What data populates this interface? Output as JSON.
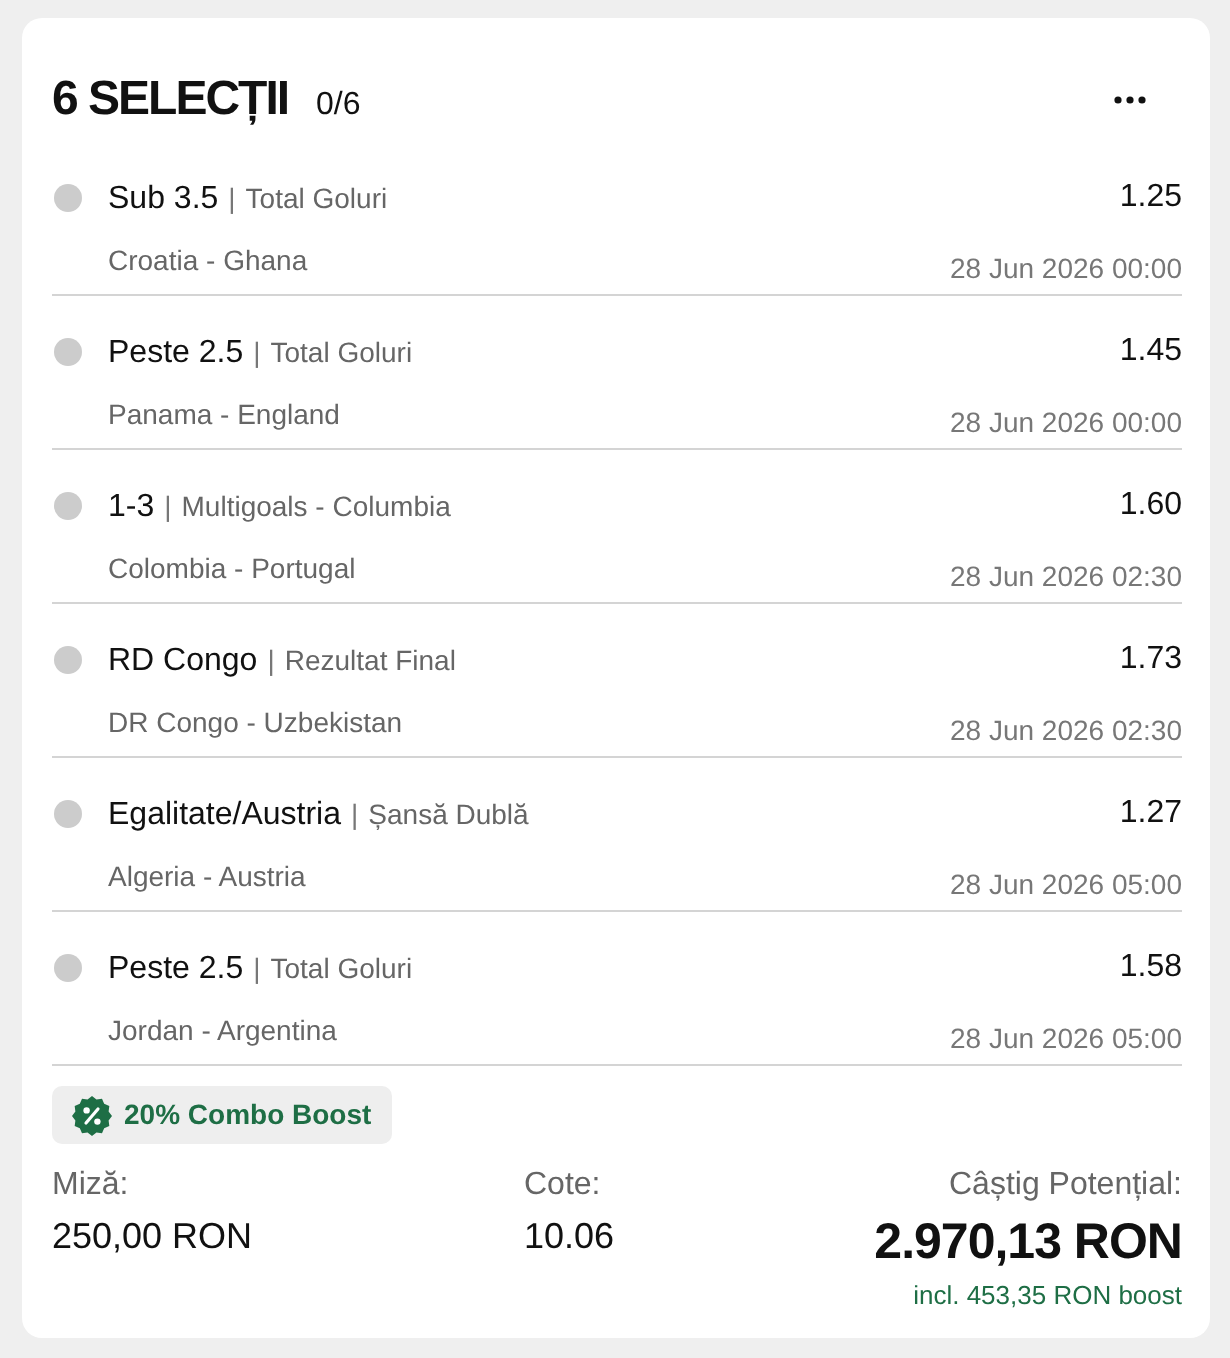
{
  "header": {
    "title": "6 SELECȚII",
    "progress": "0/6"
  },
  "selections": [
    {
      "pick": "Sub 3.5",
      "separator": "|",
      "market": "Total Goluri",
      "odds": "1.25",
      "match": "Croatia - Ghana",
      "date": "28 Jun 2026 00:00",
      "color": "#cccccc"
    },
    {
      "pick": "Peste 2.5",
      "separator": "|",
      "market": "Total Goluri",
      "odds": "1.45",
      "match": "Panama - England",
      "date": "28 Jun 2026 00:00",
      "color": "#cccccc"
    },
    {
      "pick": "1-3",
      "separator": "|",
      "market": "Multigoals - Columbia",
      "odds": "1.60",
      "match": "Colombia - Portugal",
      "date": "28 Jun 2026 02:30",
      "color": "#cccccc"
    },
    {
      "pick": "RD Congo",
      "separator": "|",
      "market": "Rezultat Final",
      "odds": "1.73",
      "match": "DR Congo - Uzbekistan",
      "date": "28 Jun 2026 02:30",
      "color": "#cccccc"
    },
    {
      "pick": "Egalitate/Austria",
      "separator": "|",
      "market": "Șansă Dublă",
      "odds": "1.27",
      "match": "Algeria - Austria",
      "date": "28 Jun 2026 05:00",
      "color": "#cccccc"
    },
    {
      "pick": "Peste 2.5",
      "separator": "|",
      "market": "Total Goluri",
      "odds": "1.58",
      "match": "Jordan - Argentina",
      "date": "28 Jun 2026 05:00",
      "color": "#cccccc"
    }
  ],
  "boost": {
    "label": "20% Combo Boost"
  },
  "summary": {
    "stake_label": "Miză:",
    "stake": "250,00 RON",
    "odds_label": "Cote:",
    "odds": "10.06",
    "payout_label": "Câștig Potențial:",
    "payout": "2.970,13 RON",
    "boost_note": "incl. 453,35 RON boost"
  }
}
